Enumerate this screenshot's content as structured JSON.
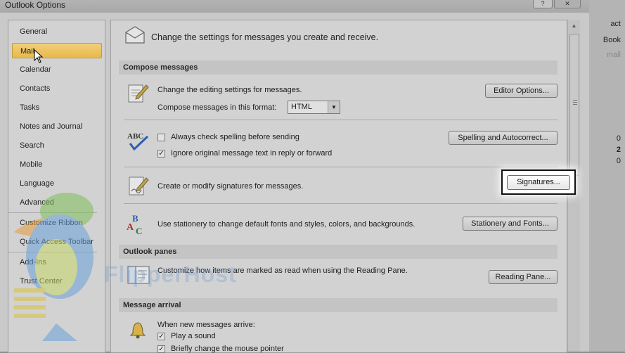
{
  "window": {
    "title": "Outlook Options"
  },
  "sidebar": {
    "items": [
      {
        "label": "General"
      },
      {
        "label": "Mail"
      },
      {
        "label": "Calendar"
      },
      {
        "label": "Contacts"
      },
      {
        "label": "Tasks"
      },
      {
        "label": "Notes and Journal"
      },
      {
        "label": "Search"
      },
      {
        "label": "Mobile"
      },
      {
        "label": "Language"
      },
      {
        "label": "Advanced"
      },
      {
        "label": "Customize Ribbon"
      },
      {
        "label": "Quick Access Toolbar"
      },
      {
        "label": "Add-Ins"
      },
      {
        "label": "Trust Center"
      }
    ],
    "selected": "Mail"
  },
  "main": {
    "intro": "Change the settings for messages you create and receive.",
    "compose": {
      "header": "Compose messages",
      "editing_text": "Change the editing settings for messages.",
      "editor_button": "Editor Options...",
      "format_label": "Compose messages in this format:",
      "format_value": "HTML",
      "spell_check_label": "Always check spelling before sending",
      "spell_check_checked": false,
      "ignore_label": "Ignore original message text in reply or forward",
      "ignore_checked": true,
      "spelling_button": "Spelling and Autocorrect...",
      "signature_text": "Create or modify signatures for messages.",
      "signatures_button": "Signatures...",
      "stationery_text": "Use stationery to change default fonts and styles, colors, and backgrounds.",
      "stationery_button": "Stationery and Fonts..."
    },
    "panes": {
      "header": "Outlook panes",
      "reading_text": "Customize how items are marked as read when using the Reading Pane.",
      "reading_button": "Reading Pane..."
    },
    "arrival": {
      "header": "Message arrival",
      "when_text": "When new messages arrive:",
      "play_sound_label": "Play a sound",
      "play_sound_checked": true,
      "pointer_label": "Briefly change the mouse pointer",
      "pointer_checked": true
    }
  },
  "background": {
    "right_texts": [
      "act",
      "Book",
      "mail"
    ],
    "numbers": [
      "0",
      "2",
      "0"
    ]
  },
  "watermark": {
    "text": "FlipperHost"
  }
}
